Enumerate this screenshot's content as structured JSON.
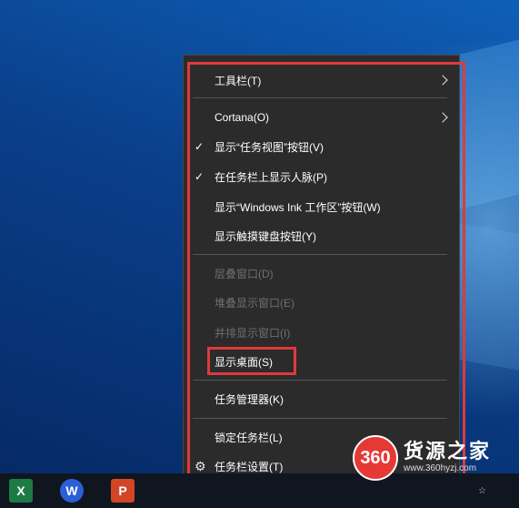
{
  "menu": {
    "toolbars": "工具栏(T)",
    "cortana": "Cortana(O)",
    "show_task_view": "显示“任务视图”按钮(V)",
    "show_people": "在任务栏上显示人脉(P)",
    "show_ink": "显示“Windows Ink 工作区”按钮(W)",
    "show_touch_keyboard": "显示触摸键盘按钮(Y)",
    "cascade": "层叠窗口(D)",
    "stacked": "堆叠显示窗口(E)",
    "side_by_side": "并排显示窗口(I)",
    "show_desktop": "显示桌面(S)",
    "task_manager": "任务管理器(K)",
    "lock_taskbar": "锁定任务栏(L)",
    "taskbar_settings": "任务栏设置(T)",
    "check_mark": "✓"
  },
  "taskbar": {
    "excel_glyph": "X",
    "wps_glyph": "W",
    "ppt_glyph": "P"
  },
  "watermark": {
    "logo": "360",
    "title": "货源之家",
    "url": "www.360hyzj.com"
  },
  "colors": {
    "menu_bg": "#2b2b2b",
    "highlight": "#e0393d",
    "disabled_text": "#6f6f6f",
    "taskbar_bg": "#10161f"
  },
  "icons": [
    "chevron-right-icon",
    "check-icon",
    "gear-icon",
    "excel-icon",
    "wps-icon",
    "powerpoint-icon",
    "logo-360"
  ]
}
